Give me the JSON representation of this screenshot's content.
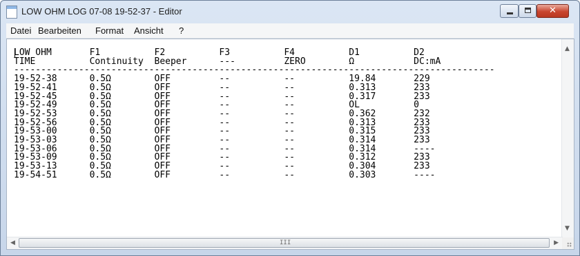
{
  "window": {
    "title": "LOW OHM LOG 07-08 19-52-37 - Editor",
    "buttons": {
      "minimize": "minimize",
      "maximize": "maximize",
      "close": "✕"
    }
  },
  "menu": {
    "items": [
      "Datei",
      "Bearbeiten",
      "Format",
      "Ansicht",
      "?"
    ]
  },
  "document": {
    "content": "LOW OHM       F1          F2          F3          F4          D1          D2\nTIME          Continuity  Beeper      ---         ZERO        Ω           DC:mA\n-----------------------------------------------------------------------------------------\n19-52-38      0.5Ω        OFF         --          --          19.84       229\n19-52-41      0.5Ω        OFF         --          --          0.313       233\n19-52-45      0.5Ω        OFF         --          --          0.317       233\n19-52-49      0.5Ω        OFF         --          --          OL          0\n19-52-53      0.5Ω        OFF         --          --          0.362       232\n19-52-56      0.5Ω        OFF         --          --          0.313       233\n19-53-00      0.5Ω        OFF         --          --          0.315       233\n19-53-03      0.5Ω        OFF         --          --          0.314       233\n19-53-06      0.5Ω        OFF         --          --          0.314       ----\n19-53-09      0.5Ω        OFF         --          --          0.312       233\n19-53-13      0.5Ω        OFF         --          --          0.304       233\n19-54-51      0.5Ω        OFF         --          --          0.303       ----"
  },
  "scrollbars": {
    "up_arrow": "▲",
    "down_arrow": "▼",
    "left_arrow": "◀",
    "right_arrow": "▶",
    "grip": "III"
  }
}
